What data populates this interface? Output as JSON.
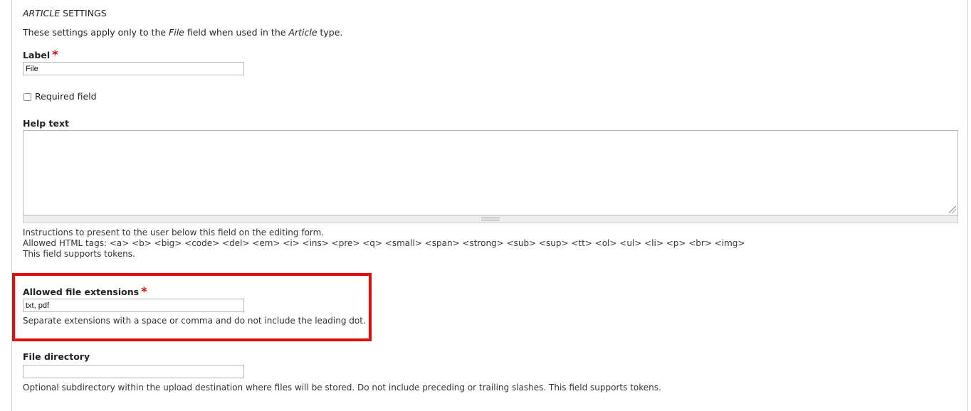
{
  "fieldset": {
    "legend_prefix": "ARTICLE",
    "legend_suffix": "SETTINGS"
  },
  "intro": {
    "part1": "These settings apply only to the ",
    "field_name": "File",
    "part2": " field when used in the ",
    "type_name": "Article",
    "part3": " type."
  },
  "label_field": {
    "label": "Label",
    "required_mark": "*",
    "value": "File"
  },
  "required_field": {
    "label": "Required field",
    "checked": false
  },
  "help_text": {
    "label": "Help text",
    "value": "",
    "description_line1": "Instructions to present to the user below this field on the editing form.",
    "description_line2": "Allowed HTML tags: <a> <b> <big> <code> <del> <em> <i> <ins> <pre> <q> <small> <span> <strong> <sub> <sup> <tt> <ol> <ul> <li> <p> <br> <img>",
    "description_line3": "This field supports tokens."
  },
  "allowed_extensions": {
    "label": "Allowed file extensions",
    "required_mark": "*",
    "value": "txt, pdf",
    "description": "Separate extensions with a space or comma and do not include the leading dot."
  },
  "file_directory": {
    "label": "File directory",
    "value": "",
    "description": "Optional subdirectory within the upload destination where files will be stored. Do not include preceding or trailing slashes. This field supports tokens."
  },
  "colors": {
    "required": "#e00707",
    "highlight_box": "#e60b0b"
  }
}
